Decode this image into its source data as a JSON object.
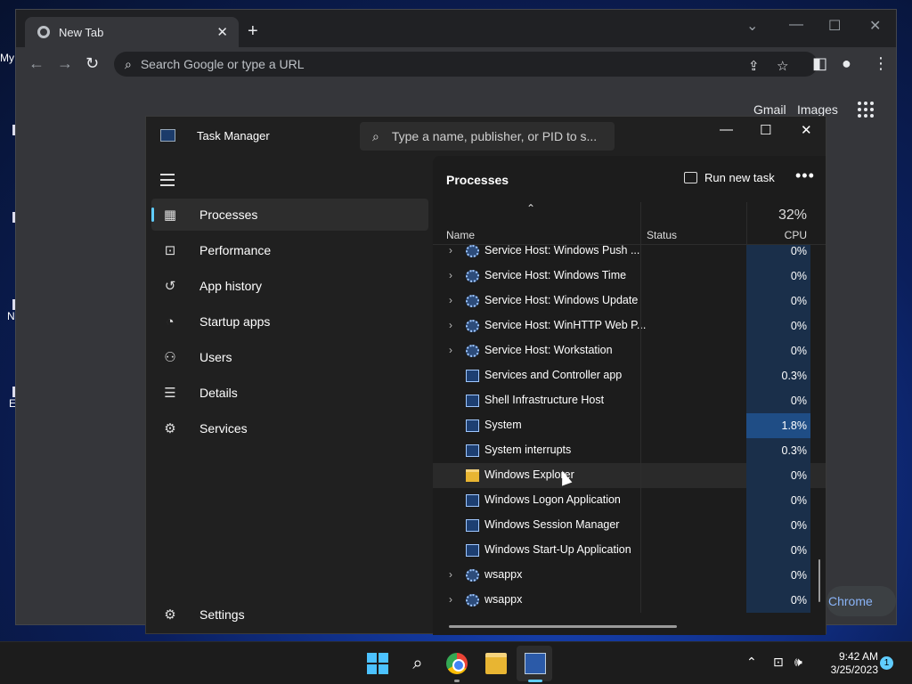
{
  "desktop": {
    "icons": [
      {
        "label": "My"
      },
      {
        "label": "N"
      },
      {
        "label": "E"
      }
    ]
  },
  "chrome": {
    "tab_title": "New Tab",
    "new_tab": "+",
    "omnibox_placeholder": "Search Google or type a URL",
    "links": {
      "gmail": "Gmail",
      "images": "Images"
    },
    "customize_pill": "Chrome"
  },
  "task_manager": {
    "title": "Task Manager",
    "search_placeholder": "Type a name, publisher, or PID to s...",
    "nav": [
      {
        "label": "Processes",
        "icon": "processes-icon",
        "active": true
      },
      {
        "label": "Performance",
        "icon": "performance-icon"
      },
      {
        "label": "App history",
        "icon": "app-history-icon"
      },
      {
        "label": "Startup apps",
        "icon": "startup-apps-icon"
      },
      {
        "label": "Users",
        "icon": "users-icon"
      },
      {
        "label": "Details",
        "icon": "details-icon"
      },
      {
        "label": "Services",
        "icon": "services-icon"
      }
    ],
    "settings_label": "Settings",
    "page_title": "Processes",
    "run_new_task": "Run new task",
    "columns": {
      "name": "Name",
      "status": "Status",
      "cpu_total": "32%",
      "cpu": "CPU"
    },
    "processes": [
      {
        "name": "Service Host: Windows Push ...",
        "expandable": true,
        "icon": "gear",
        "cpu": "0%"
      },
      {
        "name": "Service Host: Windows Time",
        "expandable": true,
        "icon": "gear",
        "cpu": "0%"
      },
      {
        "name": "Service Host: Windows Update",
        "expandable": true,
        "icon": "gear",
        "cpu": "0%"
      },
      {
        "name": "Service Host: WinHTTP Web P...",
        "expandable": true,
        "icon": "gear",
        "cpu": "0%"
      },
      {
        "name": "Service Host: Workstation",
        "expandable": true,
        "icon": "gear",
        "cpu": "0%"
      },
      {
        "name": "Services and Controller app",
        "expandable": false,
        "icon": "app",
        "cpu": "0.3%"
      },
      {
        "name": "Shell Infrastructure Host",
        "expandable": false,
        "icon": "app",
        "cpu": "0%"
      },
      {
        "name": "System",
        "expandable": false,
        "icon": "app",
        "cpu": "1.8%"
      },
      {
        "name": "System interrupts",
        "expandable": false,
        "icon": "app",
        "cpu": "0.3%"
      },
      {
        "name": "Windows Explorer",
        "expandable": false,
        "icon": "folder",
        "cpu": "0%"
      },
      {
        "name": "Windows Logon Application",
        "expandable": false,
        "icon": "app",
        "cpu": "0%"
      },
      {
        "name": "Windows Session Manager",
        "expandable": false,
        "icon": "app",
        "cpu": "0%"
      },
      {
        "name": "Windows Start-Up Application",
        "expandable": false,
        "icon": "app",
        "cpu": "0%"
      },
      {
        "name": "wsappx",
        "expandable": true,
        "icon": "gear",
        "cpu": "0%"
      },
      {
        "name": "wsappx",
        "expandable": true,
        "icon": "gear",
        "cpu": "0%"
      }
    ]
  },
  "taskbar": {
    "time": "9:42 AM",
    "date": "3/25/2023",
    "notification_count": "1"
  }
}
